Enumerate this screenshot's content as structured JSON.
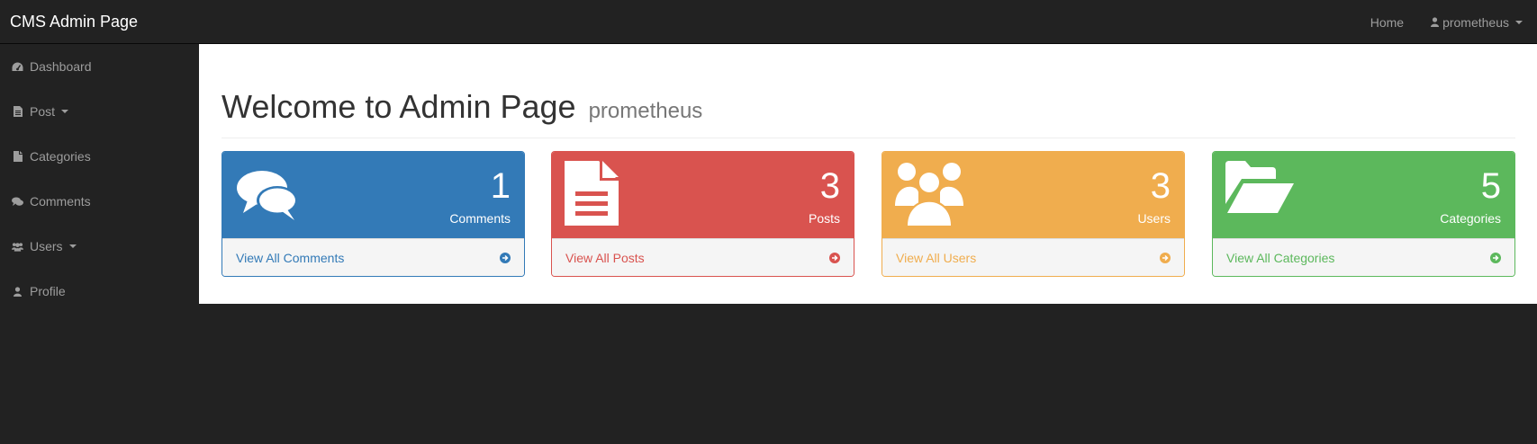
{
  "navbar": {
    "brand": "CMS Admin Page",
    "home": "Home",
    "user": "prometheus"
  },
  "sidebar": {
    "items": [
      {
        "label": "Dashboard",
        "icon": "dashboard-icon"
      },
      {
        "label": "Post",
        "icon": "file-text-icon",
        "dropdown": true
      },
      {
        "label": "Categories",
        "icon": "file-icon"
      },
      {
        "label": "Comments",
        "icon": "comments-icon"
      },
      {
        "label": "Users",
        "icon": "users-icon",
        "dropdown": true
      },
      {
        "label": "Profile",
        "icon": "user-icon"
      }
    ]
  },
  "header": {
    "title": "Welcome to Admin Page",
    "subtitle": "prometheus"
  },
  "panels": [
    {
      "count": "1",
      "label": "Comments",
      "link": "View All Comments",
      "icon": "comments-icon",
      "color": "#337ab7"
    },
    {
      "count": "3",
      "label": "Posts",
      "link": "View All Posts",
      "icon": "file-text-icon",
      "color": "#d9534f"
    },
    {
      "count": "3",
      "label": "Users",
      "link": "View All Users",
      "icon": "users-icon",
      "color": "#f0ad4e"
    },
    {
      "count": "5",
      "label": "Categories",
      "link": "View All Categories",
      "icon": "folder-open-icon",
      "color": "#5cb85c"
    }
  ]
}
